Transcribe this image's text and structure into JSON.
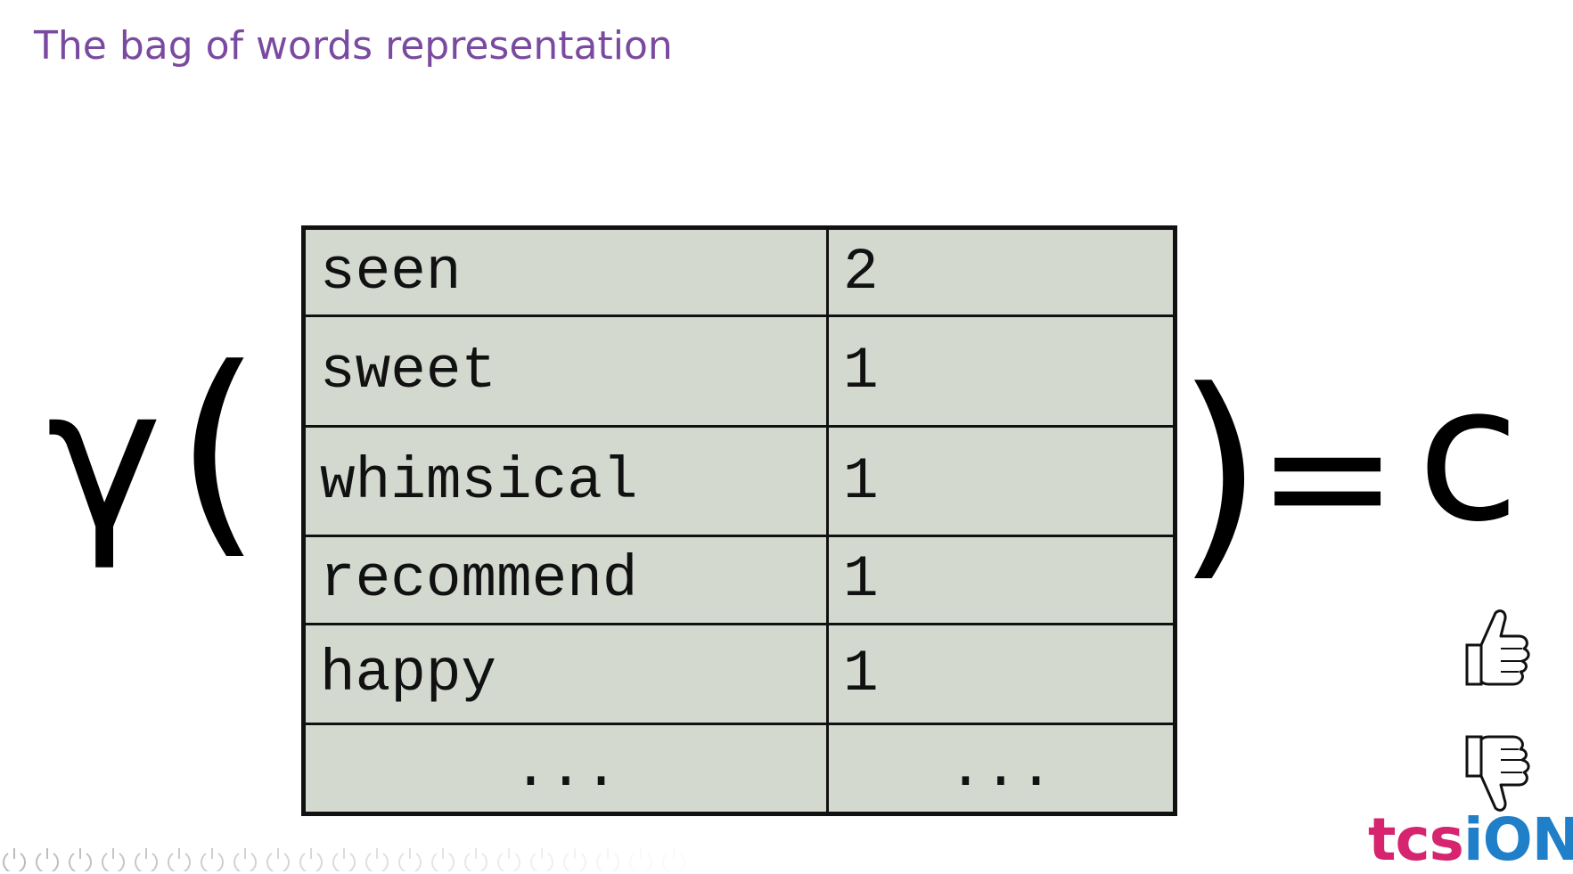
{
  "slide": {
    "title": "The bag of words representation"
  },
  "formula": {
    "function": "γ",
    "open_paren": "(",
    "close_paren": ")",
    "equals": "=",
    "result": "c"
  },
  "table": {
    "rows": [
      {
        "word": "seen",
        "count": "2"
      },
      {
        "word": "sweet",
        "count": "1"
      },
      {
        "word": "whimsical",
        "count": "1"
      },
      {
        "word": "recommend",
        "count": "1"
      },
      {
        "word": "happy",
        "count": "1"
      },
      {
        "word": "...",
        "count": "..."
      }
    ]
  },
  "icons": {
    "thumbs_up": "thumbs-up-icon",
    "thumbs_down": "thumbs-down-icon"
  },
  "logo": {
    "part1": "tcs",
    "part2": "iON",
    "color1": "#d6246e",
    "color2": "#1f7fc8"
  },
  "colors": {
    "title": "#7a4aa0",
    "table_bg": "#d4d9d0"
  }
}
